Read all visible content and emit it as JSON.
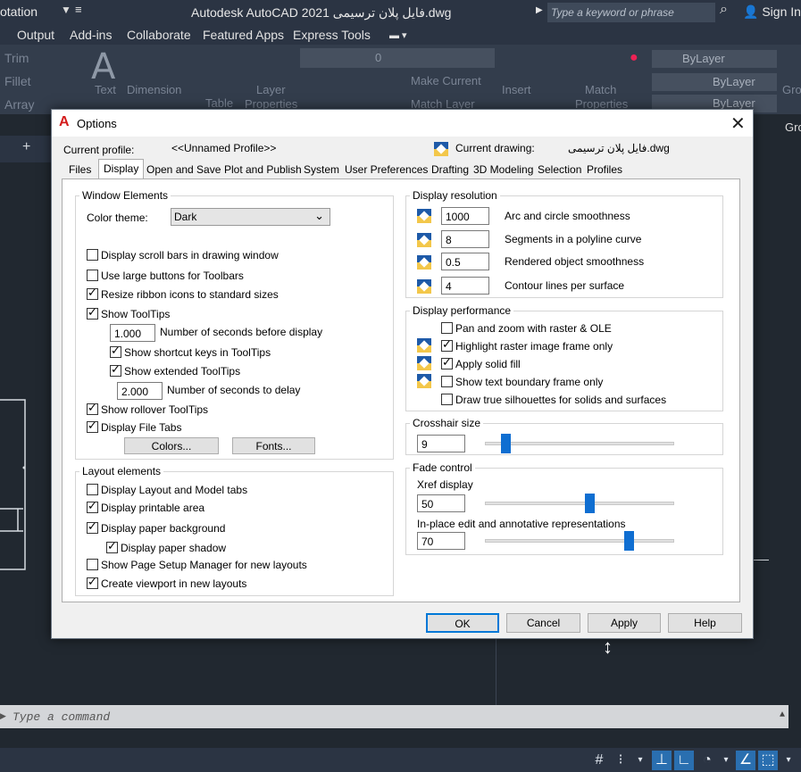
{
  "app": {
    "left_label": "otation",
    "title": "Autodesk AutoCAD 2021  فایل پلان ترسیمی.dwg",
    "search_placeholder": "Type a keyword or phrase",
    "signin": "Sign In"
  },
  "menu": [
    "Output",
    "Add-ins",
    "Collaborate",
    "Featured Apps",
    "Express Tools"
  ],
  "ribbon": {
    "trim": "Trim",
    "fillet": "Fillet",
    "array": "Array",
    "text": "Text",
    "dimension": "Dimension",
    "table": "Table",
    "layer_props": "Layer",
    "layer_props2": "Properties",
    "layer_value": "0",
    "make_current": "Make Current",
    "match_layer": "Match Layer",
    "insert": "Insert",
    "match": "Match",
    "properties": "Properties",
    "bylayer1": "ByLayer",
    "bylayer2": "ByLayer",
    "bylayer3": "ByLayer",
    "gro1": "Gro",
    "gro2": "Gro"
  },
  "tabstrip": {
    "plus": "+"
  },
  "cmdline": {
    "placeholder": "Type a command"
  },
  "dialog": {
    "title": "Options",
    "current_profile_label": "Current profile:",
    "current_profile_value": "<<Unnamed Profile>>",
    "current_drawing_label": "Current drawing:",
    "current_drawing_value": "فایل پلان ترسیمی.dwg",
    "tabs": [
      "Files",
      "Display",
      "Open and Save",
      "Plot and Publish",
      "System",
      "User Preferences",
      "Drafting",
      "3D Modeling",
      "Selection",
      "Profiles"
    ],
    "window_elements": {
      "title": "Window Elements",
      "color_theme_label": "Color theme:",
      "color_theme_value": "Dark",
      "scroll_bars": "Display scroll bars in drawing window",
      "large_buttons": "Use large buttons for Toolbars",
      "resize_ribbon": "Resize ribbon icons to standard sizes",
      "show_tooltips": "Show ToolTips",
      "seconds_before": "1.000",
      "seconds_before_label": "Number of seconds before display",
      "shortcut_keys": "Show shortcut keys in ToolTips",
      "extended_tooltips": "Show extended ToolTips",
      "seconds_delay": "2.000",
      "seconds_delay_label": "Number of seconds to delay",
      "rollover": "Show rollover ToolTips",
      "file_tabs": "Display File Tabs",
      "colors_btn": "Colors...",
      "fonts_btn": "Fonts..."
    },
    "layout_elements": {
      "title": "Layout elements",
      "layout_model_tabs": "Display Layout and Model tabs",
      "printable_area": "Display printable area",
      "paper_background": "Display paper background",
      "paper_shadow": "Display paper shadow",
      "page_setup": "Show Page Setup Manager for new layouts",
      "create_viewport": "Create viewport in new layouts"
    },
    "display_resolution": {
      "title": "Display resolution",
      "arc_value": "1000",
      "arc_label": "Arc and circle smoothness",
      "seg_value": "8",
      "seg_label": "Segments in a polyline curve",
      "render_value": "0.5",
      "render_label": "Rendered object smoothness",
      "contour_value": "4",
      "contour_label": "Contour lines per surface"
    },
    "display_performance": {
      "title": "Display performance",
      "pan_zoom": "Pan and zoom with raster & OLE",
      "highlight_raster": "Highlight raster image frame only",
      "solid_fill": "Apply solid fill",
      "text_boundary": "Show text boundary frame only",
      "silhouettes": "Draw true silhouettes for solids and surfaces"
    },
    "crosshair": {
      "title": "Crosshair size",
      "value": "9",
      "level": 9
    },
    "fade": {
      "title": "Fade control",
      "xref_label": "Xref display",
      "xref_value": "50",
      "xref_level": 50,
      "inplace_label": "In-place edit and annotative representations",
      "inplace_value": "70",
      "inplace_level": 70
    },
    "buttons": {
      "ok": "OK",
      "cancel": "Cancel",
      "apply": "Apply",
      "help": "Help"
    }
  }
}
